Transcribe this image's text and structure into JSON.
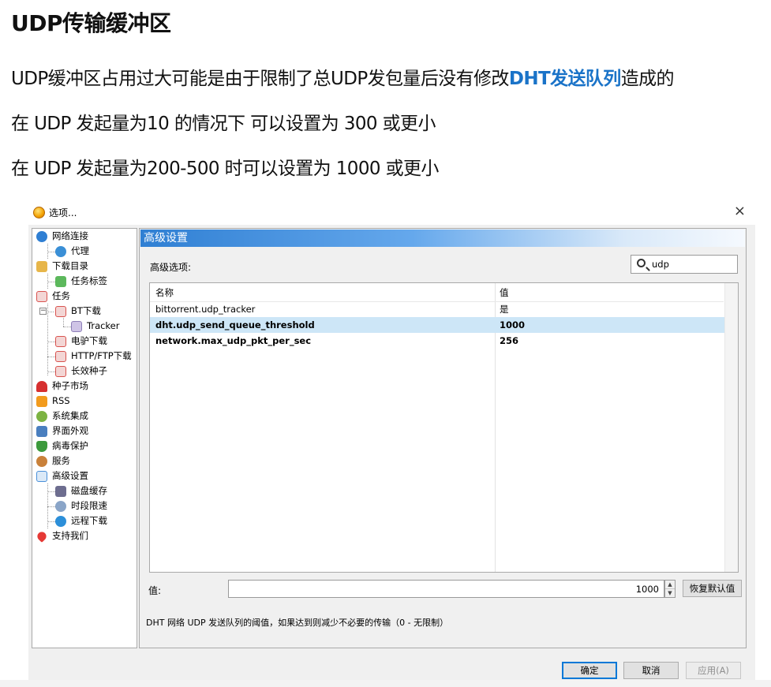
{
  "article": {
    "title": "UDP传输缓冲区",
    "para1_before": "UDP缓冲区占用过大可能是由于限制了总UDP发包量后没有修改",
    "para1_link": "DHT发送队列",
    "para1_after": "造成的",
    "para2": "在 UDP 发起量为10 的情况下 可以设置为 300 或更小",
    "para3": "在 UDP 发起量为200-500 时可以设置为 1000 或更小"
  },
  "dialog": {
    "title": "选项...",
    "close_glyph": "×",
    "tree": [
      {
        "label": "网络连接",
        "icon": "network-icon",
        "color": "#2f7fd3"
      },
      {
        "label": "代理",
        "icon": "proxy-icon",
        "color": "#3a8fd6"
      },
      {
        "label": "下载目录",
        "icon": "folder-icon",
        "color": "#e7b64a"
      },
      {
        "label": "任务标签",
        "icon": "tag-icon",
        "color": "#5cb85c"
      },
      {
        "label": "任务",
        "icon": "task-icon",
        "color": "#d9534f"
      },
      {
        "label": "BT下载",
        "icon": "task-icon",
        "color": "#d9534f"
      },
      {
        "label": "Tracker",
        "icon": "cube-icon",
        "color": "#b9a8d9"
      },
      {
        "label": "电驴下载",
        "icon": "task-icon",
        "color": "#d9534f"
      },
      {
        "label": "HTTP/FTP下载",
        "icon": "task-icon",
        "color": "#d9534f"
      },
      {
        "label": "长效种子",
        "icon": "task-icon",
        "color": "#d9534f"
      },
      {
        "label": "种子市场",
        "icon": "magnet-icon",
        "color": "#d62f2f"
      },
      {
        "label": "RSS",
        "icon": "rss-icon",
        "color": "#f29b1d"
      },
      {
        "label": "系统集成",
        "icon": "integration-icon",
        "color": "#7cb342"
      },
      {
        "label": "界面外观",
        "icon": "appearance-icon",
        "color": "#4a7fbf"
      },
      {
        "label": "病毒保护",
        "icon": "shield-icon",
        "color": "#3c9a3c"
      },
      {
        "label": "服务",
        "icon": "service-icon",
        "color": "#c9813a"
      },
      {
        "label": "高级设置",
        "icon": "advanced-icon",
        "color": "#4a90d9"
      },
      {
        "label": "磁盘缓存",
        "icon": "disk-icon",
        "color": "#6d6d8f"
      },
      {
        "label": "时段限速",
        "icon": "schedule-icon",
        "color": "#8aa5c8"
      },
      {
        "label": "远程下载",
        "icon": "remote-icon",
        "color": "#2c8fd9"
      },
      {
        "label": "支持我们",
        "icon": "heart-icon",
        "color": "#e53935"
      }
    ],
    "panel": {
      "header": "高级设置",
      "options_label": "高级选项:",
      "search_value": "udp",
      "col_name": "名称",
      "col_value": "值",
      "rows": [
        {
          "name": "bittorrent.udp_tracker",
          "value": "是"
        },
        {
          "name": "dht.udp_send_queue_threshold",
          "value": "1000"
        },
        {
          "name": "network.max_udp_pkt_per_sec",
          "value": "256"
        }
      ],
      "value_label": "值:",
      "value_field": "1000",
      "spin_up": "▲",
      "spin_down": "▼",
      "restore_label": "恢复默认值",
      "description": "DHT 网络 UDP 发送队列的阈值，如果达到则减少不必要的传输（0 - 无限制）"
    },
    "buttons": {
      "ok": "确定",
      "cancel": "取消",
      "apply": "应用(A)"
    }
  }
}
